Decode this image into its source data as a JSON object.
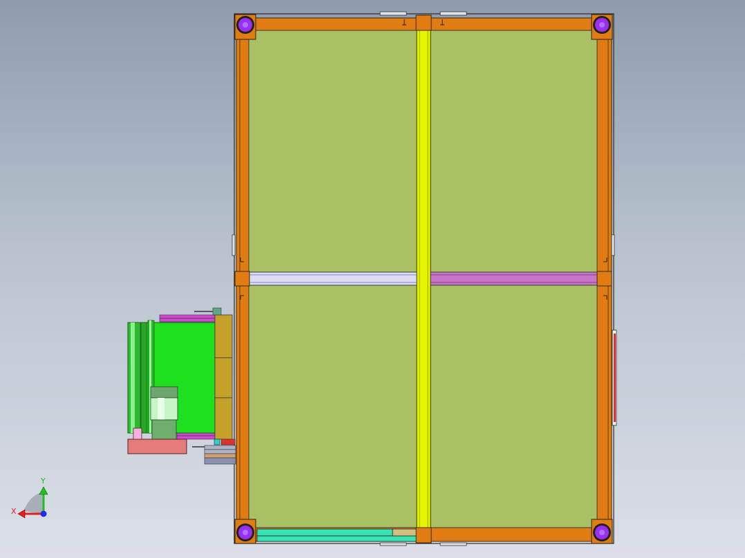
{
  "viewport": {
    "background_top": "#8e9cad",
    "background_bottom": "#dcdfe8"
  },
  "colors": {
    "frame_orange": "#e07c12",
    "frame_edge": "#3a2a10",
    "panel_green": "#a9c064",
    "center_beam_yellow": "#e8f500",
    "crossbar_left": "#dcdcf6",
    "crossbar_right": "#c776c7",
    "caster_purple": "#9a2ff0",
    "bottom_rail_cyan": "#38e3b3",
    "mech_green": "#1fe01f",
    "mech_olive": "#c6a129",
    "mech_pink": "#e57c7c",
    "mech_magenta": "#d047d0",
    "red_strip": "#e03030"
  },
  "triad": {
    "x_label": "X",
    "y_label": "Y",
    "x_color": "#e02020",
    "y_color": "#20c020",
    "z_color": "#1f2fe0"
  },
  "icons": [
    "caster-wheel-icon",
    "axis-triad-icon"
  ]
}
